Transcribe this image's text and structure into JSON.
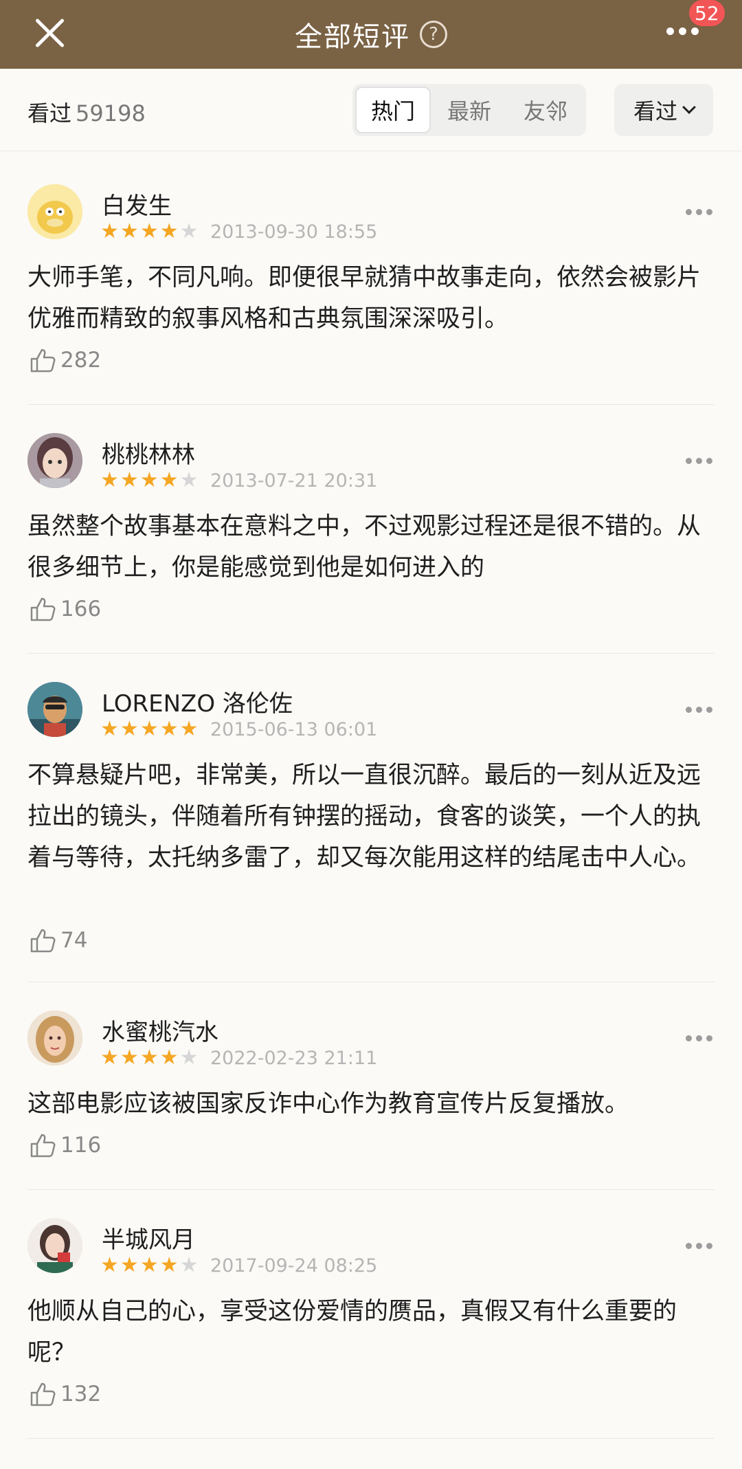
{
  "header": {
    "title": "全部短评",
    "help_glyph": "?",
    "badge_count": "52"
  },
  "filter": {
    "seen_label": "看过",
    "seen_count": "59198",
    "tabs": [
      "热门",
      "最新",
      "友邻"
    ],
    "active_tab": "热门",
    "dropdown_label": "看过"
  },
  "colors": {
    "header_bg": "#7a6244",
    "star_on": "#f5a623",
    "badge": "#f25555"
  },
  "reviews": [
    {
      "username": "白发生",
      "rating": 4,
      "date": "2013-09-30 18:55",
      "content": "大师手笔，不同凡响。即便很早就猜中故事走向，依然会被影片优雅而精致的叙事风格和古典氛围深深吸引。",
      "likes": "282"
    },
    {
      "username": "桃桃林林",
      "rating": 4,
      "date": "2013-07-21 20:31",
      "content": "虽然整个故事基本在意料之中，不过观影过程还是很不错的。从很多细节上，你是能感觉到他是如何进入的",
      "likes": "166"
    },
    {
      "username": "LORENZO 洛伦佐",
      "rating": 5,
      "date": "2015-06-13 06:01",
      "content": "不算悬疑片吧，非常美，所以一直很沉醉。最后的一刻从近及远拉出的镜头，伴随着所有钟摆的摇动，食客的谈笑，一个人的执着与等待，太托纳多雷了，却又每次能用这样的结尾击中人心。",
      "likes": "74"
    },
    {
      "username": "水蜜桃汽水",
      "rating": 4,
      "date": "2022-02-23 21:11",
      "content": "这部电影应该被国家反诈中心作为教育宣传片反复播放。",
      "likes": "116"
    },
    {
      "username": "半城风月",
      "rating": 4,
      "date": "2017-09-24 08:25",
      "content": "他顺从自己的心，享受这份爱情的赝品，真假又有什么重要的呢？",
      "likes": "132"
    }
  ]
}
